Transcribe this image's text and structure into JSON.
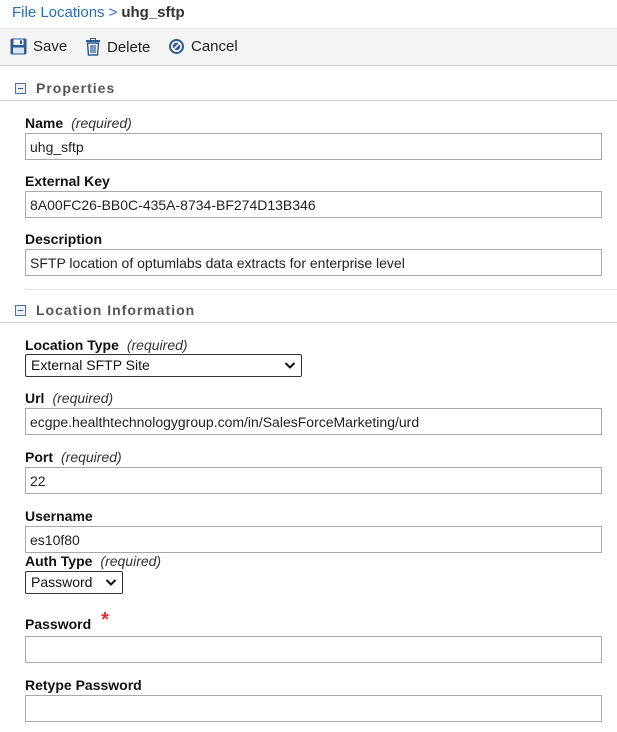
{
  "breadcrumb": {
    "parent": "File Locations",
    "separator": ">",
    "current": "uhg_sftp"
  },
  "toolbar": {
    "save": "Save",
    "delete": "Delete",
    "cancel": "Cancel"
  },
  "sections": {
    "properties": "Properties",
    "location": "Location Information"
  },
  "required_text": "(required)",
  "fields": {
    "name": {
      "label": "Name",
      "value": "uhg_sftp"
    },
    "external_key": {
      "label": "External Key",
      "value": "8A00FC26-BB0C-435A-8734-BF274D13B346"
    },
    "description": {
      "label": "Description",
      "value": "SFTP location of optumlabs data extracts for enterprise level"
    },
    "location_type": {
      "label": "Location Type",
      "value": "External SFTP Site"
    },
    "url": {
      "label": "Url",
      "value": "ecgpe.healthtechnologygroup.com/in/SalesForceMarketing/urd"
    },
    "port": {
      "label": "Port",
      "value": "22"
    },
    "username": {
      "label": "Username",
      "value": "es10f80"
    },
    "auth_type": {
      "label": "Auth Type",
      "value": "Password"
    },
    "password": {
      "label": "Password",
      "value": "",
      "required_marker": "*"
    },
    "retype_password": {
      "label": "Retype Password",
      "value": ""
    }
  },
  "colors": {
    "link": "#2a6db5",
    "required_star": "#e03030",
    "toolbar_icon": "#2d5a94"
  }
}
